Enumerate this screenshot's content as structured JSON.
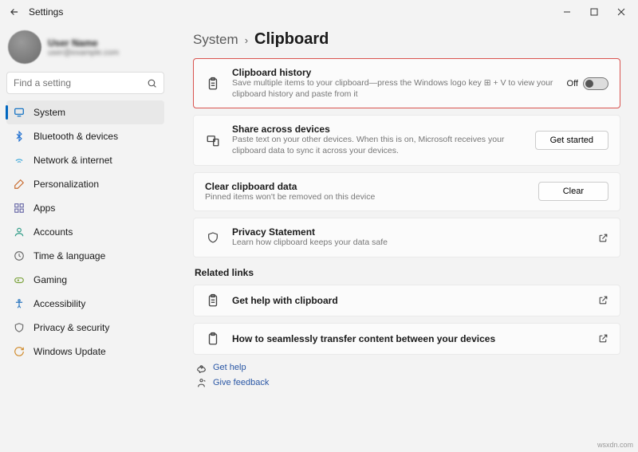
{
  "window": {
    "title": "Settings"
  },
  "user": {
    "name": "User Name",
    "email": "user@example.com"
  },
  "search": {
    "placeholder": "Find a setting"
  },
  "nav": {
    "items": [
      {
        "label": "System"
      },
      {
        "label": "Bluetooth & devices"
      },
      {
        "label": "Network & internet"
      },
      {
        "label": "Personalization"
      },
      {
        "label": "Apps"
      },
      {
        "label": "Accounts"
      },
      {
        "label": "Time & language"
      },
      {
        "label": "Gaming"
      },
      {
        "label": "Accessibility"
      },
      {
        "label": "Privacy & security"
      },
      {
        "label": "Windows Update"
      }
    ]
  },
  "breadcrumb": {
    "parent": "System",
    "current": "Clipboard"
  },
  "cards": {
    "history": {
      "title": "Clipboard history",
      "desc": "Save multiple items to your clipboard—press the Windows logo key ⊞ + V to view your clipboard history and paste from it",
      "toggle_state": "Off"
    },
    "share": {
      "title": "Share across devices",
      "desc": "Paste text on your other devices. When this is on, Microsoft receives your clipboard data to sync it across your devices.",
      "button": "Get started"
    },
    "clear": {
      "title": "Clear clipboard data",
      "desc": "Pinned items won't be removed on this device",
      "button": "Clear"
    },
    "privacy": {
      "title": "Privacy Statement",
      "desc": "Learn how clipboard keeps your data safe"
    }
  },
  "related": {
    "heading": "Related links",
    "help": "Get help with clipboard",
    "transfer": "How to seamlessly transfer content between your devices"
  },
  "footer": {
    "get_help": "Get help",
    "feedback": "Give feedback"
  },
  "watermark": "wsxdn.com"
}
